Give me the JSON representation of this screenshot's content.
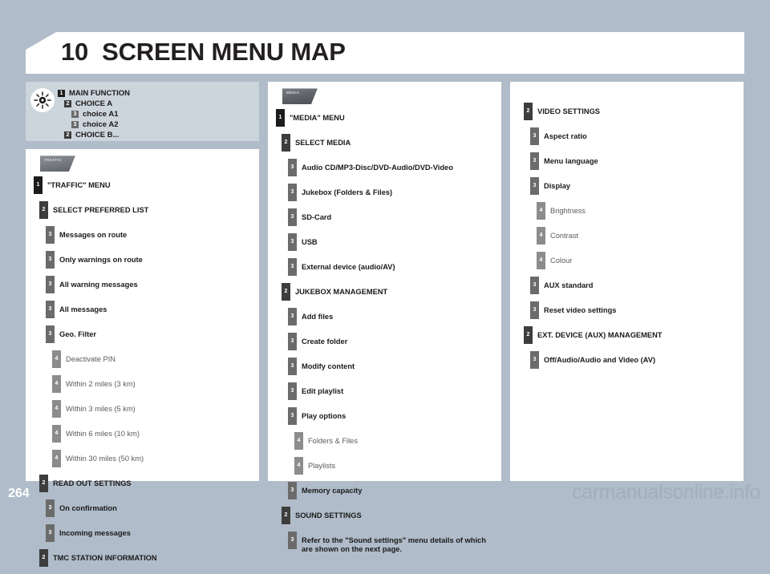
{
  "header": {
    "chapter_number": "10",
    "title": "SCREEN MENU MAP"
  },
  "legend": {
    "icon": "sun-icon",
    "rows": [
      {
        "level": "1",
        "label": "MAIN FUNCTION"
      },
      {
        "level": "2",
        "label": "CHOICE A"
      },
      {
        "level": "3",
        "label": "choice A1"
      },
      {
        "level": "3",
        "label": "choice A2"
      },
      {
        "level": "2",
        "label": "CHOICE B..."
      }
    ]
  },
  "columns": [
    {
      "id": "traffic-column",
      "button": {
        "label": "TRAFFIC",
        "style": "light"
      },
      "rows": [
        {
          "level": "1",
          "label": "\"TRAFFIC\" MENU"
        },
        {
          "level": "2",
          "label": "SELECT PREFERRED LIST"
        },
        {
          "level": "3",
          "label": "Messages on route"
        },
        {
          "level": "3",
          "label": "Only warnings on route"
        },
        {
          "level": "3",
          "label": "All warning messages"
        },
        {
          "level": "3",
          "label": "All messages"
        },
        {
          "level": "3",
          "label": "Geo. Filter"
        },
        {
          "level": "4",
          "label": "Deactivate PIN"
        },
        {
          "level": "4",
          "label": "Within 2 miles (3 km)"
        },
        {
          "level": "4",
          "label": "Within 3 miles (5 km)"
        },
        {
          "level": "4",
          "label": "Within 6 miles (10 km)"
        },
        {
          "level": "4",
          "label": "Within 30 miles (50 km)"
        },
        {
          "level": "2",
          "label": "READ OUT SETTINGS"
        },
        {
          "level": "3",
          "label": "On confirmation"
        },
        {
          "level": "3",
          "label": "Incoming messages"
        },
        {
          "level": "2",
          "label": "TMC STATION INFORMATION"
        }
      ]
    },
    {
      "id": "media-column",
      "button": {
        "label": "MEDIA",
        "style": "dark"
      },
      "rows": [
        {
          "level": "1",
          "label": "\"MEDIA\" MENU"
        },
        {
          "level": "2",
          "label": "SELECT MEDIA"
        },
        {
          "level": "3",
          "label": "Audio CD/MP3-Disc/DVD-Audio/DVD-Video"
        },
        {
          "level": "3",
          "label": "Jukebox (Folders & Files)"
        },
        {
          "level": "3",
          "label": "SD-Card"
        },
        {
          "level": "3",
          "label": "USB"
        },
        {
          "level": "3",
          "label": "External device (audio/AV)"
        },
        {
          "level": "2",
          "label": "JUKEBOX MANAGEMENT"
        },
        {
          "level": "3",
          "label": "Add files"
        },
        {
          "level": "3",
          "label": "Create folder"
        },
        {
          "level": "3",
          "label": "Modify content"
        },
        {
          "level": "3",
          "label": "Edit playlist"
        },
        {
          "level": "3",
          "label": "Play options"
        },
        {
          "level": "4",
          "label": "Folders & Files"
        },
        {
          "level": "4",
          "label": "Playlists"
        },
        {
          "level": "3",
          "label": "Memory capacity"
        },
        {
          "level": "2",
          "label": "SOUND SETTINGS"
        },
        {
          "level": "3",
          "label": "Refer to the \"Sound settings\" menu details of which are shown on the next page."
        }
      ]
    },
    {
      "id": "video-column",
      "button": null,
      "rows": [
        {
          "level": "2",
          "label": "VIDEO SETTINGS"
        },
        {
          "level": "3",
          "label": "Aspect ratio"
        },
        {
          "level": "3",
          "label": "Menu language"
        },
        {
          "level": "3",
          "label": "Display"
        },
        {
          "level": "4",
          "label": "Brightness"
        },
        {
          "level": "4",
          "label": "Contrast"
        },
        {
          "level": "4",
          "label": "Colour"
        },
        {
          "level": "3",
          "label": "AUX standard"
        },
        {
          "level": "3",
          "label": "Reset video settings"
        },
        {
          "level": "2",
          "label": "EXT. DEVICE (AUX) MANAGEMENT"
        },
        {
          "level": "3",
          "label": "Off/Audio/Audio and Video (AV)"
        }
      ]
    }
  ],
  "footer": {
    "page_number": "264",
    "watermark": "carmanualsonline.info"
  },
  "colors": {
    "background": "#b0bcc9",
    "paper": "#ffffff",
    "legend_card": "#ccd4dc",
    "level1": "#1c1c1c",
    "level2": "#3d3d3d",
    "level3": "#6b6b6b",
    "level4": "#8c8c8c",
    "watermark": "#a2aebb"
  }
}
